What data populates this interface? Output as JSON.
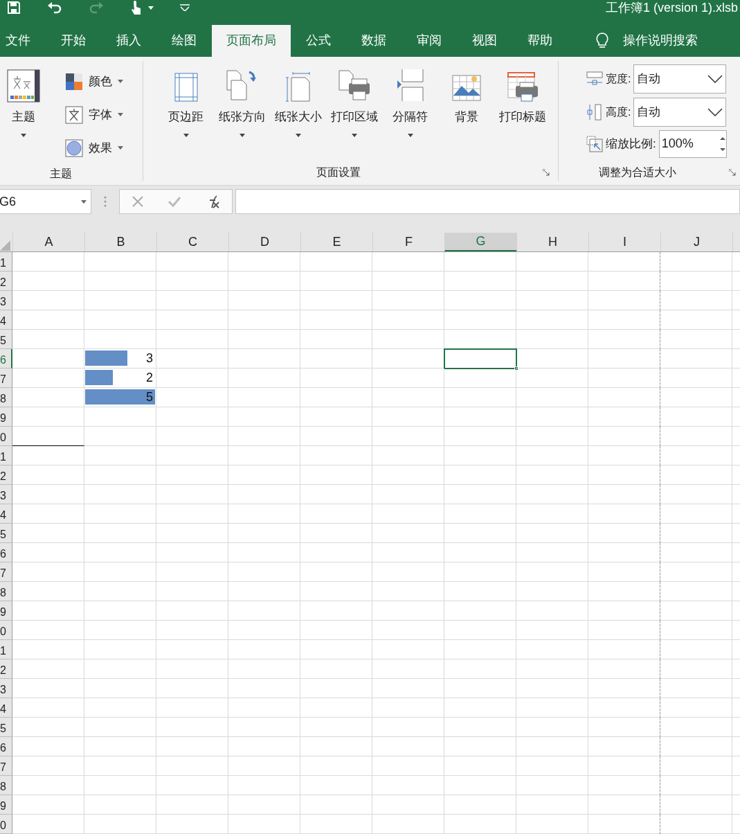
{
  "quick_access": [
    {
      "kind": "save",
      "disabled": false
    },
    {
      "kind": "undo",
      "disabled": false
    },
    {
      "kind": "redo",
      "disabled": true
    },
    {
      "kind": "touch",
      "disabled": false
    },
    {
      "kind": "customize",
      "disabled": false
    }
  ],
  "window": {
    "title": "工作簿1 (version 1).xlsb"
  },
  "tabs": [
    {
      "label": "文件",
      "selected": false
    },
    {
      "label": "开始",
      "selected": false
    },
    {
      "label": "插入",
      "selected": false
    },
    {
      "label": "绘图",
      "selected": false
    },
    {
      "label": "页面布局",
      "selected": true
    },
    {
      "label": "公式",
      "selected": false
    },
    {
      "label": "数据",
      "selected": false
    },
    {
      "label": "审阅",
      "selected": false
    },
    {
      "label": "视图",
      "selected": false
    },
    {
      "label": "帮助",
      "selected": false
    }
  ],
  "tell_me": {
    "label": "操作说明搜索"
  },
  "themes_group": {
    "label": "主题",
    "big_button": {
      "label": "主题"
    },
    "items": [
      {
        "kind": "colors",
        "label": "颜色"
      },
      {
        "kind": "fonts",
        "label": "字体"
      },
      {
        "kind": "effects",
        "label": "效果"
      }
    ]
  },
  "page_setup_group": {
    "label": "页面设置",
    "buttons": [
      {
        "kind": "margins",
        "label": "页边距",
        "dropdown": true
      },
      {
        "kind": "orientation",
        "label": "纸张方向",
        "dropdown": true
      },
      {
        "kind": "size",
        "label": "纸张大小",
        "dropdown": true
      },
      {
        "kind": "print_area",
        "label": "打印区域",
        "dropdown": true
      },
      {
        "kind": "breaks",
        "label": "分隔符",
        "dropdown": true
      },
      {
        "kind": "background",
        "label": "背景",
        "dropdown": false
      },
      {
        "kind": "print_titles",
        "label": "打印标题",
        "dropdown": false
      }
    ]
  },
  "scale_group": {
    "label": "调整为合适大小",
    "width": {
      "label": "宽度:",
      "value": "自动"
    },
    "height": {
      "label": "高度:",
      "value": "自动"
    },
    "scale": {
      "label": "缩放比例:",
      "value": "100%"
    }
  },
  "formula_bar": {
    "name_box": "G6"
  },
  "sheet": {
    "columns": [
      {
        "label": "A",
        "selected": false
      },
      {
        "label": "B",
        "selected": false
      },
      {
        "label": "C",
        "selected": false
      },
      {
        "label": "D",
        "selected": false
      },
      {
        "label": "E",
        "selected": false
      },
      {
        "label": "F",
        "selected": false
      },
      {
        "label": "G",
        "selected": true
      },
      {
        "label": "H",
        "selected": false
      },
      {
        "label": "I",
        "selected": false
      },
      {
        "label": "J",
        "selected": false
      }
    ],
    "rows": [
      {
        "label": "1",
        "selected": false
      },
      {
        "label": "2",
        "selected": false
      },
      {
        "label": "3",
        "selected": false
      },
      {
        "label": "4",
        "selected": false
      },
      {
        "label": "5",
        "selected": false
      },
      {
        "label": "6",
        "selected": true,
        "b": {
          "value": "3",
          "level": 0.6
        }
      },
      {
        "label": "7",
        "selected": false,
        "b": {
          "value": "2",
          "level": 0.4
        }
      },
      {
        "label": "8",
        "selected": false,
        "b": {
          "value": "5",
          "level": 1
        }
      },
      {
        "label": "9",
        "selected": false
      },
      {
        "label": "0",
        "selected": false,
        "a_border_bottom": true
      },
      {
        "label": "1",
        "selected": false
      },
      {
        "label": "2",
        "selected": false
      },
      {
        "label": "3",
        "selected": false
      },
      {
        "label": "4",
        "selected": false
      },
      {
        "label": "5",
        "selected": false
      },
      {
        "label": "6",
        "selected": false
      },
      {
        "label": "7",
        "selected": false
      },
      {
        "label": "8",
        "selected": false
      },
      {
        "label": "9",
        "selected": false
      },
      {
        "label": "0",
        "selected": false
      },
      {
        "label": "1",
        "selected": false
      },
      {
        "label": "2",
        "selected": false
      },
      {
        "label": "3",
        "selected": false
      },
      {
        "label": "4",
        "selected": false
      },
      {
        "label": "5",
        "selected": false
      },
      {
        "label": "6",
        "selected": false
      },
      {
        "label": "7",
        "selected": false
      },
      {
        "label": "8",
        "selected": false
      },
      {
        "label": "9",
        "selected": false
      },
      {
        "label": "0",
        "selected": false
      }
    ]
  }
}
